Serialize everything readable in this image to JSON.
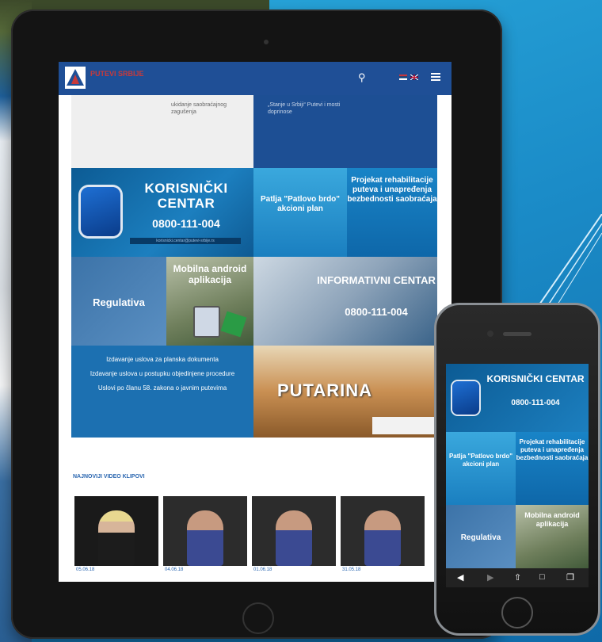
{
  "colors": {
    "brand": "#1f4f96",
    "accent": "#c83a3a",
    "tile_blue": "#1c70b1",
    "background": "#1b8cc8"
  },
  "header": {
    "logo_text": "PUTEVI SRBIJE",
    "search_icon": "search-icon",
    "flags": [
      "flag-serbia",
      "flag-uk"
    ],
    "menu_icon": "hamburger-menu-icon"
  },
  "top_strip": {
    "left_text": "ukidanje saobraćajnog zagušenja",
    "right_text": "„Stanje u Srbiji“ Putevi i mosti doprinose"
  },
  "tiles": {
    "korisnicki": {
      "title": "KORISNIČKI CENTAR",
      "phone": "0800-111-004",
      "email": "korisnicki.centar@putevi-srbije.rs"
    },
    "patlja": "Patlja \"Patlovo brdo\" akcioni plan",
    "projekat": "Projekat rehabilitacije puteva i unapređenja bezbednosti saobraćaja",
    "regulativa": "Regulativa",
    "mobilna": "Mobilna android aplikacija",
    "informativni": {
      "title": "INFORMATIVNI CENTAR",
      "phone": "0800-111-004"
    },
    "links": [
      "Izdavanje uslova za planska dokumenta",
      "Izdavanje uslova u postupku objedinjene procedure",
      "Uslovi po članu 58. zakona o javnim putevima"
    ],
    "putarina": "PUTARINA"
  },
  "videos": {
    "heading": "NAJNOVIJI VIDEO KLIPOVI",
    "items": [
      {
        "date": "05.06.18"
      },
      {
        "date": "04.06.18"
      },
      {
        "date": "01.06.18"
      },
      {
        "date": "31.05.18"
      }
    ]
  },
  "phone_screen": {
    "korisnicki_title": "KORISNIČKI CENTAR",
    "korisnicki_phone": "0800-111-004",
    "patlja": "Patlja \"Patlovo brdo\" akcioni plan",
    "projekat": "Projekat rehabilitacije puteva i unapređenja bezbednosti saobraćaja",
    "regulativa": "Regulativa",
    "mobilna": "Mobilna android aplikacija"
  }
}
